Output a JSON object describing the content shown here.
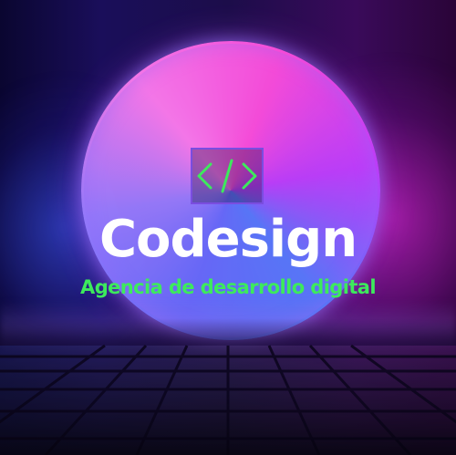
{
  "brand": {
    "name": "Codesign",
    "tagline": "Agencia de desarrollo digital",
    "logo_icon": "code-brackets-icon"
  },
  "colors": {
    "title": "#ffffff",
    "tagline": "#3dea5c",
    "logo_stroke": "#3dea5c",
    "logo_frame": "#7a4de0",
    "ring_blue": "#6a6cff",
    "ring_magenta": "#ff4fe0"
  }
}
